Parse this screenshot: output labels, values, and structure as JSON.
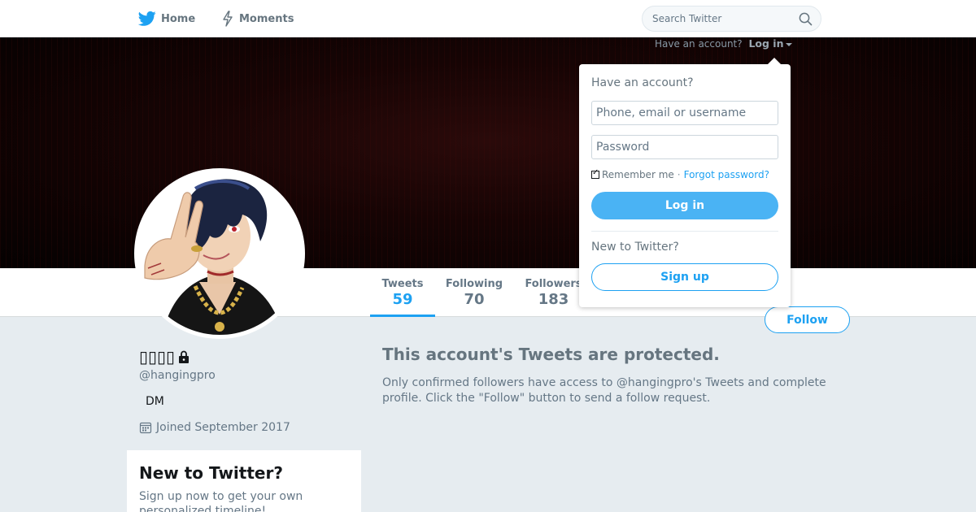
{
  "nav": {
    "home_label": "Home",
    "moments_label": "Moments",
    "home_icon": "twitter-bird-icon",
    "moments_icon": "lightning-icon"
  },
  "search": {
    "placeholder": "Search Twitter",
    "icon": "search-icon"
  },
  "header_login": {
    "prompt": "Have an account?",
    "link_label": "Log in"
  },
  "login_dropdown": {
    "heading": "Have an account?",
    "username_placeholder": "Phone, email or username",
    "password_placeholder": "Password",
    "remember_label": "Remember me",
    "separator": "·",
    "forgot_label": "Forgot password?",
    "login_button": "Log in",
    "new_heading": "New to Twitter?",
    "signup_button": "Sign up"
  },
  "stats": {
    "tweets": {
      "label": "Tweets",
      "value": "59"
    },
    "following": {
      "label": "Following",
      "value": "70"
    },
    "followers": {
      "label": "Followers",
      "value": "183"
    }
  },
  "follow_button": "Follow",
  "profile": {
    "display_name": "▯▯▯▯",
    "handle": "@hangingpro",
    "bio": "DM",
    "joined": "Joined September 2017"
  },
  "protected": {
    "title": "This account's Tweets are protected.",
    "text": "Only confirmed followers have access to @hangingpro's Tweets and complete profile. Click the \"Follow\" button to send a follow request."
  },
  "signup_card": {
    "title": "New to Twitter?",
    "text": "Sign up now to get your own personalized timeline!"
  },
  "colors": {
    "accent": "#1da1f2",
    "background": "#e6ecf0",
    "muted_text": "#657786"
  }
}
